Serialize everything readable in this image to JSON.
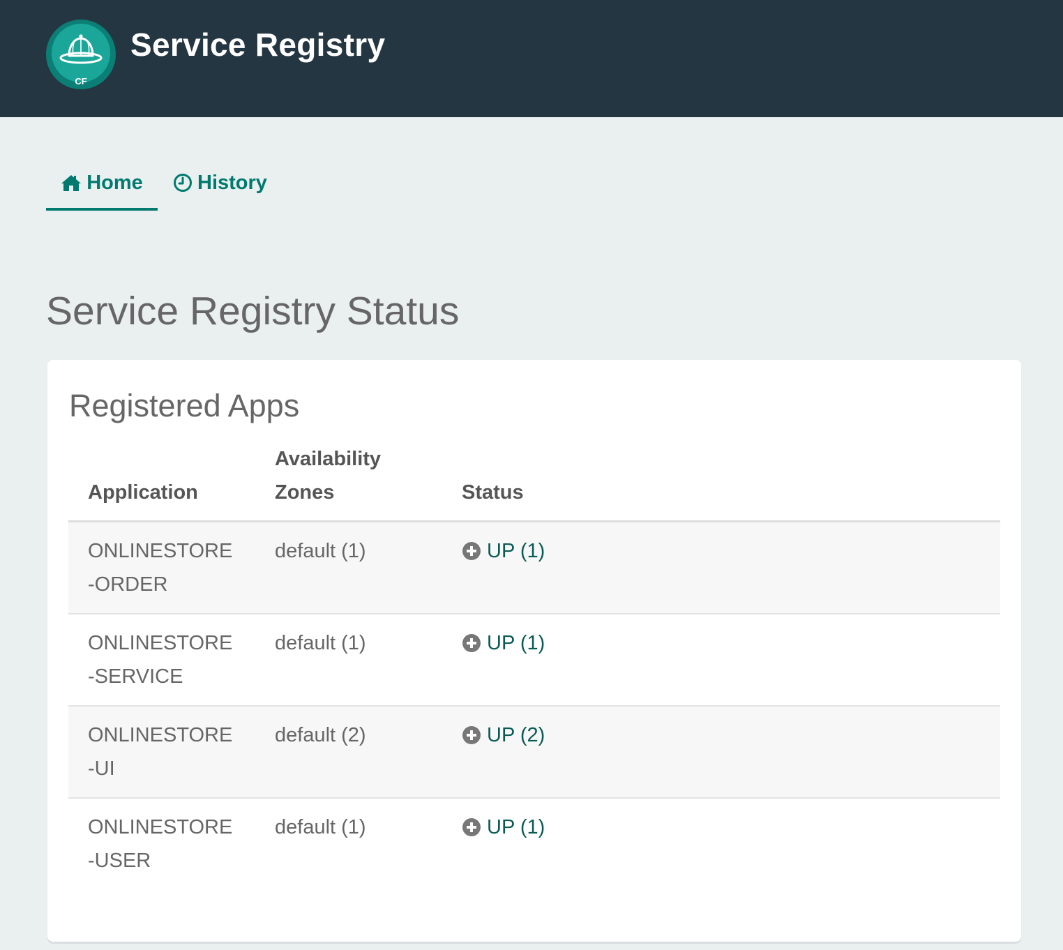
{
  "header": {
    "logo_text": "CF",
    "title": "Service Registry"
  },
  "nav": {
    "tabs": [
      {
        "label": "Home",
        "icon": "home-icon",
        "active": true
      },
      {
        "label": "History",
        "icon": "clock-icon",
        "active": false
      }
    ]
  },
  "page": {
    "title": "Service Registry Status"
  },
  "panel": {
    "title": "Registered Apps",
    "columns": [
      "Application",
      "Availability Zones",
      "Status"
    ],
    "rows": [
      {
        "application": "ONLINESTORE-ORDER",
        "zones": "default (1)",
        "status": "UP (1)",
        "status_icon": "plus-circle-icon"
      },
      {
        "application": "ONLINESTORE-SERVICE",
        "zones": "default (1)",
        "status": "UP (1)",
        "status_icon": "plus-circle-icon"
      },
      {
        "application": "ONLINESTORE-UI",
        "zones": "default (2)",
        "status": "UP (2)",
        "status_icon": "plus-circle-icon"
      },
      {
        "application": "ONLINESTORE-USER",
        "zones": "default (1)",
        "status": "UP (1)",
        "status_icon": "plus-circle-icon"
      }
    ]
  },
  "colors": {
    "header_bg": "#243641",
    "accent": "#007a6f",
    "logo_teal": "#1aa79a",
    "status_link": "#0b5b55"
  }
}
